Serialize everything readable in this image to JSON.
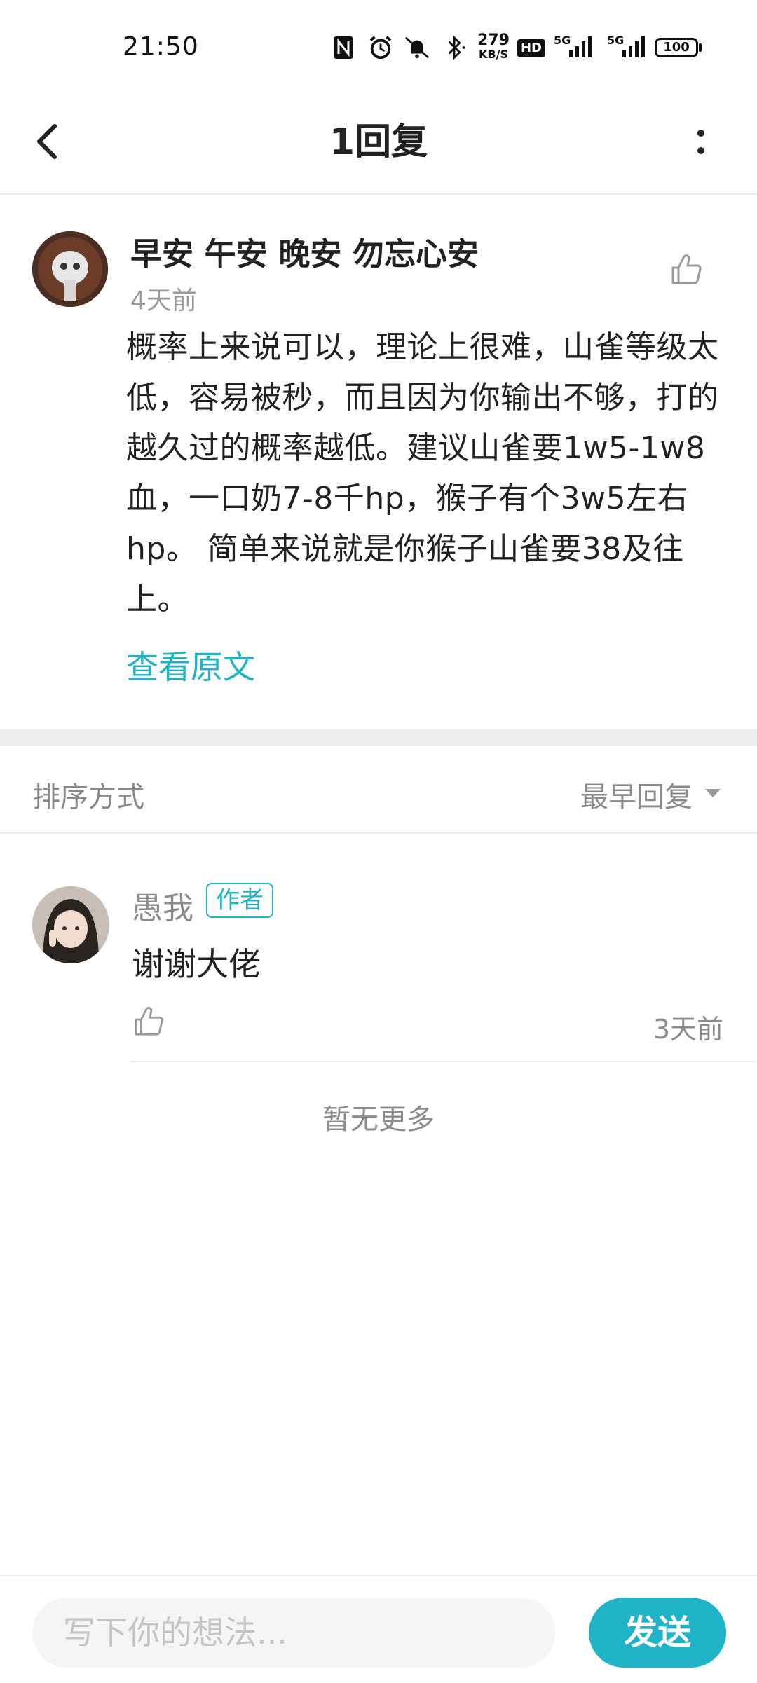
{
  "status_bar": {
    "time": "21:50",
    "network_speed_value": "279",
    "network_speed_unit": "KB/S",
    "hd_label": "HD",
    "signal1_label": "5G",
    "signal2_label": "5G",
    "battery": "100",
    "icons": [
      "nfc-icon",
      "alarm-icon",
      "mute-icon",
      "bluetooth-icon",
      "hd-icon",
      "signal-icon",
      "signal-icon",
      "battery-icon"
    ]
  },
  "header": {
    "title": "1回复",
    "back_icon": "back-arrow-icon",
    "more_icon": "more-vertical-icon"
  },
  "main_comment": {
    "user_name": "早安 午安 晚安 勿忘心安",
    "time": "4天前",
    "text": "概率上来说可以，理论上很难，山雀等级太低，容易被秒，而且因为你输出不够，打的越久过的概率越低。建议山雀要1w5-1w8血，一口奶7-8千hp，猴子有个3w5左右hp。 简单来说就是你猴子山雀要38及往上。",
    "view_original": "查看原文",
    "like_icon": "thumbs-up-icon"
  },
  "sort": {
    "label": "排序方式",
    "value": "最早回复"
  },
  "replies": [
    {
      "user_name": "愚我",
      "badge": "作者",
      "text": "谢谢大佬",
      "time": "3天前"
    }
  ],
  "no_more": "暂无更多",
  "composer": {
    "placeholder": "写下你的想法...",
    "send_label": "发送"
  },
  "colors": {
    "accent": "#1fb3c5",
    "text_primary": "#222222",
    "text_secondary": "#8c8c8c",
    "divider": "#efefef"
  }
}
